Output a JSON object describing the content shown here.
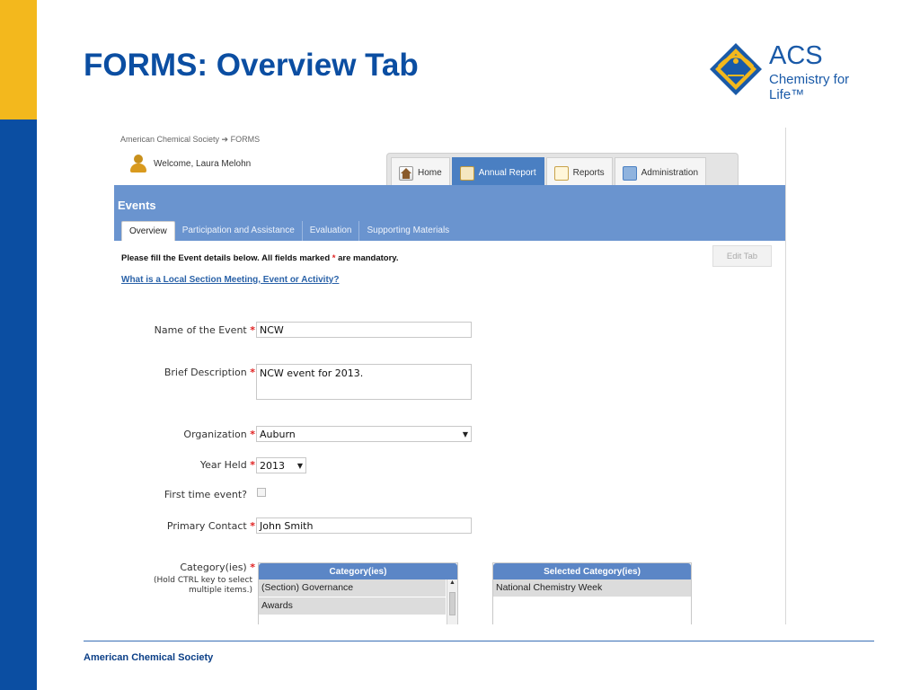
{
  "slide": {
    "title": "FORMS:  Overview Tab",
    "logo": {
      "name": "ACS",
      "tagline": "Chemistry for Life™"
    },
    "footer": "American Chemical Society",
    "colors": {
      "blue": "#0b4ea2",
      "gold": "#f3b81d"
    }
  },
  "app": {
    "breadcrumb": "American Chemical Society  ➔  FORMS",
    "welcome": "Welcome, Laura Melohn",
    "nav": [
      {
        "label": "Home",
        "icon": "home-icon"
      },
      {
        "label": "Annual Report",
        "icon": "report-icon"
      },
      {
        "label": "Reports",
        "icon": "clipboard-icon"
      },
      {
        "label": "Administration",
        "icon": "admin-icon"
      }
    ],
    "section_title": "Events",
    "subtabs": [
      "Overview",
      "Participation and Assistance",
      "Evaluation",
      "Supporting Materials"
    ],
    "instructions_pre": "Please fill the Event details below. All fields marked ",
    "instructions_star": "*",
    "instructions_post": " are mandatory.",
    "edit_tab": "Edit Tab",
    "help_link": "What is a Local Section Meeting, Event or Activity?",
    "form": {
      "name_label": "Name of the Event",
      "name_value": "NCW",
      "desc_label": "Brief Description",
      "desc_value": "NCW event for 2013.",
      "org_label": "Organization",
      "org_value": "Auburn",
      "year_label": "Year Held",
      "year_value": "2013",
      "first_time_label": "First time event?",
      "contact_label": "Primary Contact",
      "contact_value": "John Smith",
      "category_label": "Category(ies)",
      "category_hint": "(Hold CTRL key to select multiple items.)",
      "star": "*"
    },
    "categories": {
      "header": "Category(ies)",
      "items": [
        "(Section) Governance",
        "Awards"
      ]
    },
    "selected": {
      "header": "Selected Category(ies)",
      "items": [
        "National Chemistry Week"
      ]
    }
  }
}
